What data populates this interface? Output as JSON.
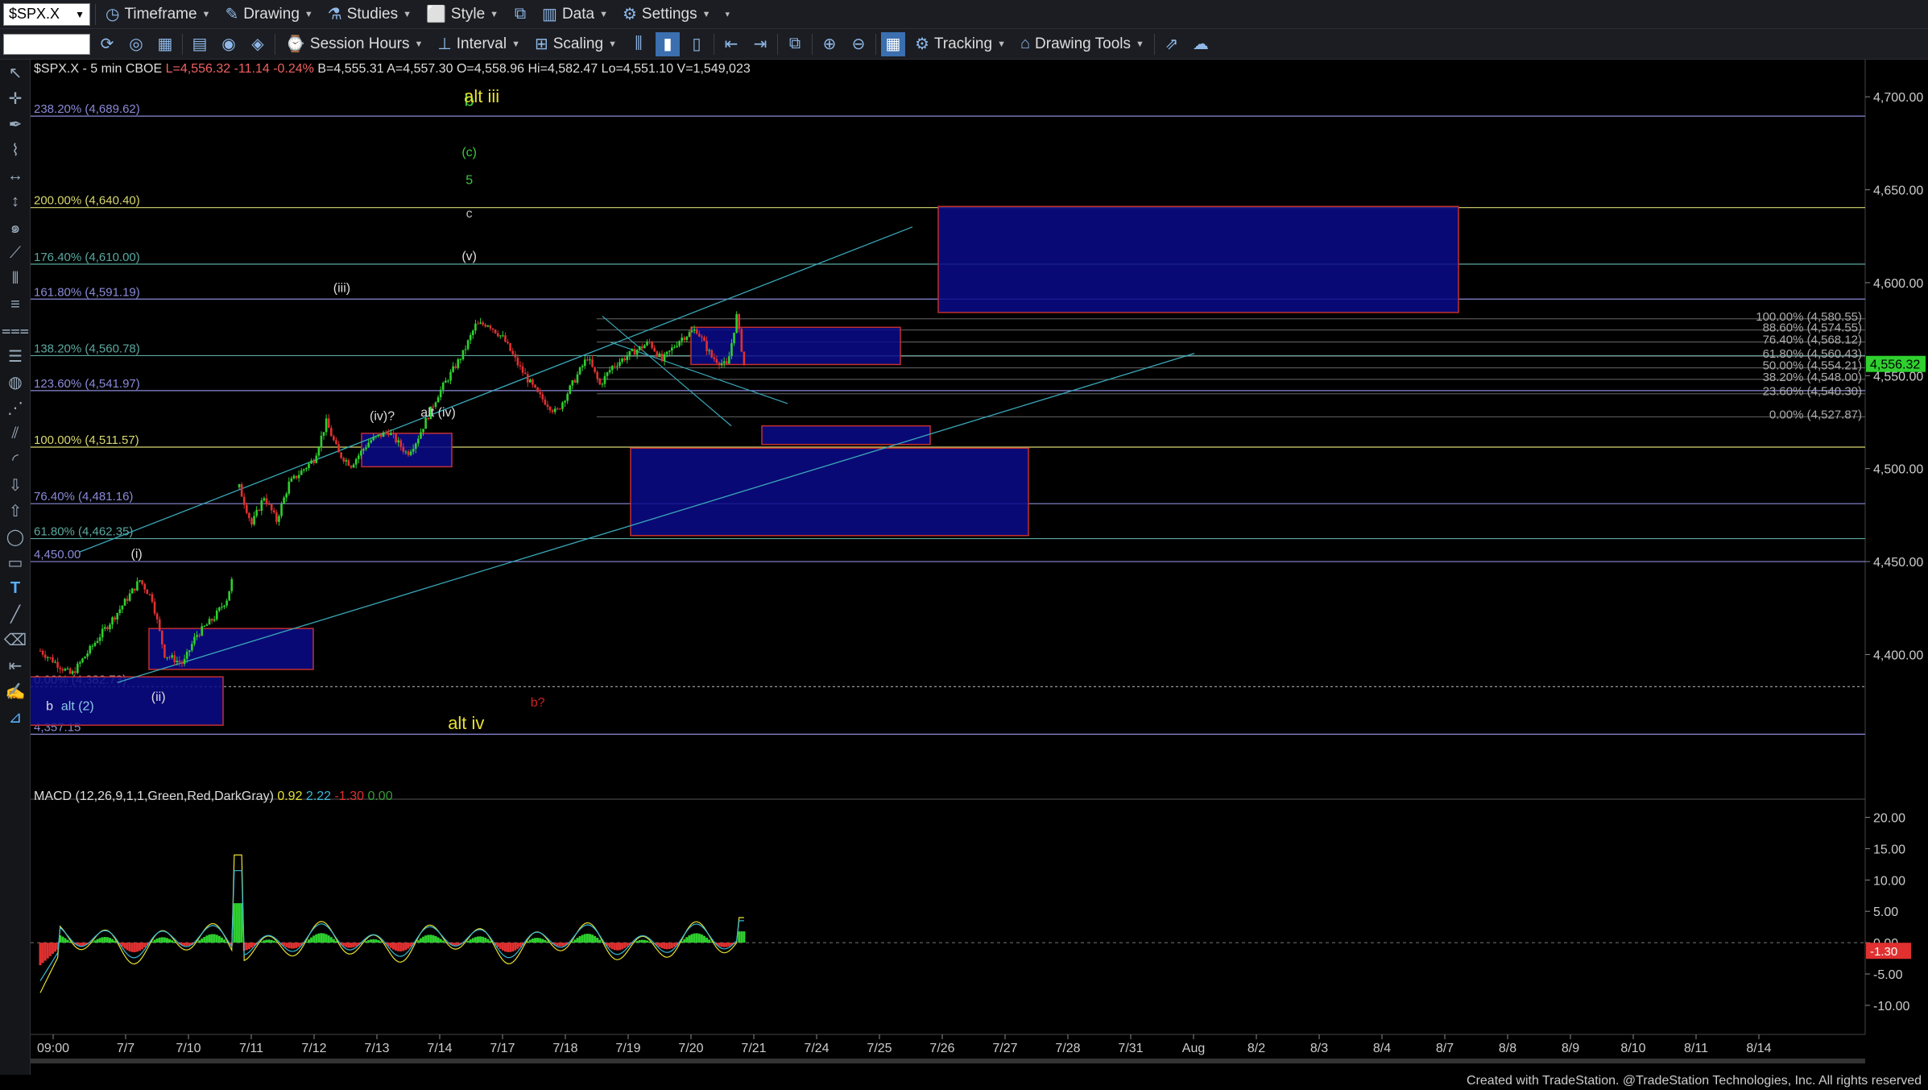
{
  "toolbar1": {
    "symbol": "$SPX.X",
    "items": [
      {
        "icon": "timeframe-icon",
        "label": "Timeframe"
      },
      {
        "icon": "drawing-icon",
        "label": "Drawing"
      },
      {
        "icon": "studies-icon",
        "label": "Studies"
      },
      {
        "icon": "style-icon",
        "label": "Style"
      },
      {
        "icon": "data-icon",
        "label": "Data"
      },
      {
        "icon": "settings-icon",
        "label": "Settings"
      }
    ]
  },
  "toolbar2": {
    "items": [
      {
        "icon": "session-hours-icon",
        "label": "Session Hours"
      },
      {
        "icon": "interval-icon",
        "label": "Interval"
      },
      {
        "icon": "scaling-icon",
        "label": "Scaling"
      },
      {
        "icon": "tracking-icon",
        "label": "Tracking"
      },
      {
        "icon": "drawing-tools-icon",
        "label": "Drawing Tools"
      }
    ]
  },
  "header": {
    "symbol": "$SPX.X - 5 min  CBOE",
    "last": "L=4,556.32",
    "change": "-11.14",
    "pct": "-0.24%",
    "bid": "B=4,555.31",
    "ask": "A=4,557.30",
    "open": "O=4,558.96",
    "high": "Hi=4,582.47",
    "low": "Lo=4,551.10",
    "vol": "V=1,549,023"
  },
  "macd": {
    "label": "MACD (12,26,9,1,1,Green,Red,DarkGray)",
    "v1": "0.92",
    "v2": "2.22",
    "v3": "-1.30",
    "v4": "0.00",
    "current": "-1.30"
  },
  "chart_data": {
    "type": "candlestick",
    "ylim": [
      4330,
      4720
    ],
    "price_ticks": [
      "4,700.00",
      "4,650.00",
      "4,600.00",
      "4,550.00",
      "4,500.00",
      "4,450.00",
      "4,400.00"
    ],
    "last_price": "4,556.32",
    "macd_ylim": [
      -14,
      22
    ],
    "macd_ticks": [
      "20.00",
      "15.00",
      "10.00",
      "5.00",
      "0.00",
      "-5.00",
      "-10.00"
    ],
    "dates": [
      "09:00",
      "7/7",
      "7/10",
      "7/11",
      "7/12",
      "7/13",
      "7/14",
      "7/17",
      "7/18",
      "7/19",
      "7/20",
      "7/21",
      "7/24",
      "7/25",
      "7/26",
      "7/27",
      "7/28",
      "7/31",
      "Aug",
      "8/2",
      "8/3",
      "8/4",
      "8/7",
      "8/8",
      "8/9",
      "8/10",
      "8/11",
      "8/14"
    ],
    "fib_left": [
      {
        "label": "238.20% (4,689.62)",
        "value": 4689.62,
        "color": "#8a8ad8"
      },
      {
        "label": "200.00% (4,640.40)",
        "value": 4640.4,
        "color": "#d8d870"
      },
      {
        "label": "176.40% (4,610.00)",
        "value": 4610.0,
        "color": "#5aa8a0"
      },
      {
        "label": "161.80% (4,591.19)",
        "value": 4591.19,
        "color": "#8a8ad8"
      },
      {
        "label": "138.20% (4,560.78)",
        "value": 4560.78,
        "color": "#5aa8a0"
      },
      {
        "label": "123.60% (4,541.97)",
        "value": 4541.97,
        "color": "#8a8ad8"
      },
      {
        "label": "100.00% (4,511.57)",
        "value": 4511.57,
        "color": "#d8d870"
      },
      {
        "label": "76.40% (4,481.16)",
        "value": 4481.16,
        "color": "#8a8ad8"
      },
      {
        "label": "61.80% (4,462.35)",
        "value": 4462.35,
        "color": "#5aa8a0"
      },
      {
        "label": "4,450.00",
        "value": 4450.0,
        "color": "#8a8ad8"
      },
      {
        "label": "0.00% (4,382.73)",
        "value": 4382.73,
        "color": "#aaaaaa"
      },
      {
        "label": "4,357.15",
        "value": 4357.15,
        "color": "#8a8ad8"
      }
    ],
    "fib_right": [
      {
        "label": "100.00% (4,580.55)",
        "value": 4580.55
      },
      {
        "label": "88.60% (4,574.55)",
        "value": 4574.55
      },
      {
        "label": "76.40% (4,568.12)",
        "value": 4568.12
      },
      {
        "label": "61.80% (4,560.43)",
        "value": 4560.43
      },
      {
        "label": "50.00% (4,554.21)",
        "value": 4554.21
      },
      {
        "label": "38.20% (4,548.00)",
        "value": 4548.0
      },
      {
        "label": "23.60% (4,540.30)",
        "value": 4540.3
      },
      {
        "label": "0.00% (4,527.87)",
        "value": 4527.87
      }
    ],
    "wave_labels": [
      {
        "text": "b",
        "color": "#3cc83c",
        "x": 6.9,
        "y": 4695
      },
      {
        "text": "alt iii",
        "color": "#e8e030",
        "x": 7.1,
        "y": 4697
      },
      {
        "text": "(c)",
        "color": "#3cc83c",
        "x": 6.9,
        "y": 4668
      },
      {
        "text": "5",
        "color": "#3cc83c",
        "x": 6.9,
        "y": 4653
      },
      {
        "text": "c",
        "color": "#bbbbbb",
        "x": 6.9,
        "y": 4635
      },
      {
        "text": "(v)",
        "color": "#dddddd",
        "x": 6.9,
        "y": 4612
      },
      {
        "text": "(iii)",
        "color": "#dddddd",
        "x": 4.85,
        "y": 4595
      },
      {
        "text": "(iv)?",
        "color": "#dddddd",
        "x": 5.5,
        "y": 4526
      },
      {
        "text": "alt (iv)",
        "color": "#dddddd",
        "x": 6.4,
        "y": 4528
      },
      {
        "text": "(i)",
        "color": "#dddddd",
        "x": 1.55,
        "y": 4452
      },
      {
        "text": "(ii)",
        "color": "#dddddd",
        "x": 1.9,
        "y": 4375
      },
      {
        "text": "b",
        "color": "#dddddd",
        "x": 0.15,
        "y": 4370
      },
      {
        "text": "alt (2)",
        "color": "#8ac8e8",
        "x": 0.6,
        "y": 4370
      },
      {
        "text": "b?",
        "color": "#d02020",
        "x": 8.0,
        "y": 4372
      },
      {
        "text": "alt iv",
        "color": "#e8e030",
        "x": 6.85,
        "y": 4360
      }
    ]
  },
  "footer": "Created with TradeStation. @TradeStation Technologies, Inc. All rights reserved"
}
